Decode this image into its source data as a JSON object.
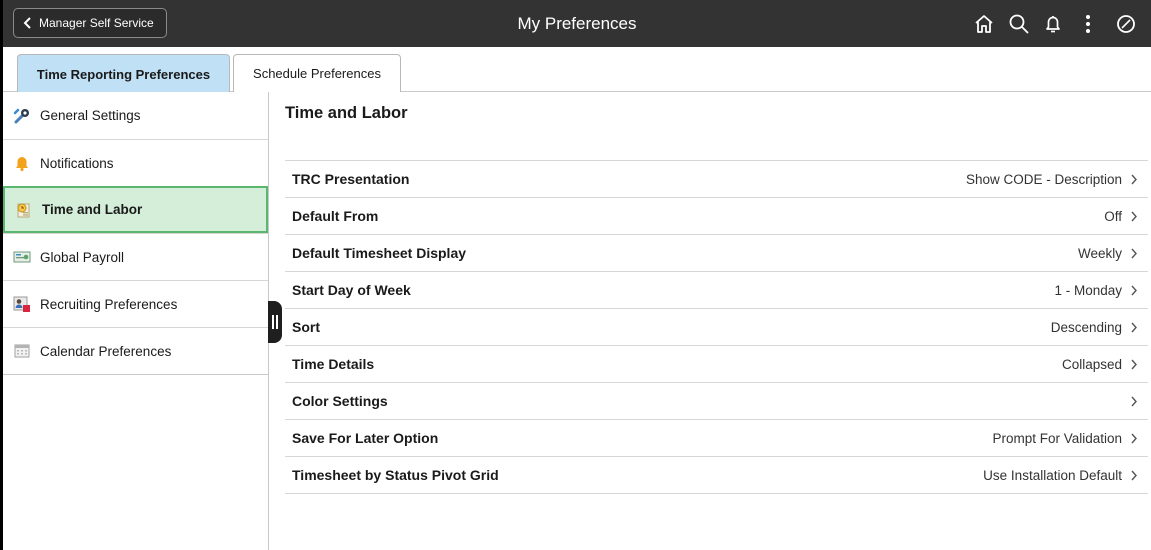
{
  "header": {
    "back_label": "Manager Self Service",
    "title": "My Preferences",
    "icons": [
      "home-icon",
      "search-icon",
      "bell-icon",
      "more-icon",
      "navbar-icon"
    ]
  },
  "tabs": [
    {
      "label": "Time Reporting Preferences",
      "active": true
    },
    {
      "label": "Schedule Preferences",
      "active": false
    }
  ],
  "sidebar": {
    "items": [
      {
        "label": "General Settings",
        "icon": "wrench-icon"
      },
      {
        "label": "Notifications",
        "icon": "bell-icon"
      },
      {
        "label": "Time and Labor",
        "icon": "timesheet-icon",
        "active": true
      },
      {
        "label": "Global Payroll",
        "icon": "payroll-icon"
      },
      {
        "label": "Recruiting Preferences",
        "icon": "recruiting-icon"
      },
      {
        "label": "Calendar Preferences",
        "icon": "calendar-icon"
      }
    ]
  },
  "main": {
    "title": "Time and Labor",
    "rows": [
      {
        "label": "TRC Presentation",
        "value": "Show CODE - Description"
      },
      {
        "label": "Default From",
        "value": "Off"
      },
      {
        "label": "Default Timesheet Display",
        "value": "Weekly"
      },
      {
        "label": "Start Day of Week",
        "value": "1 - Monday"
      },
      {
        "label": "Sort",
        "value": "Descending"
      },
      {
        "label": "Time Details",
        "value": "Collapsed"
      },
      {
        "label": "Color Settings",
        "value": ""
      },
      {
        "label": "Save For Later Option",
        "value": "Prompt For Validation"
      },
      {
        "label": "Timesheet by Status Pivot Grid",
        "value": "Use Installation Default"
      }
    ]
  },
  "colors": {
    "header_bg": "#333333",
    "active_tab": "#bfe0f5",
    "active_side_bg": "#d4eed9",
    "active_side_border": "#59b86e"
  }
}
